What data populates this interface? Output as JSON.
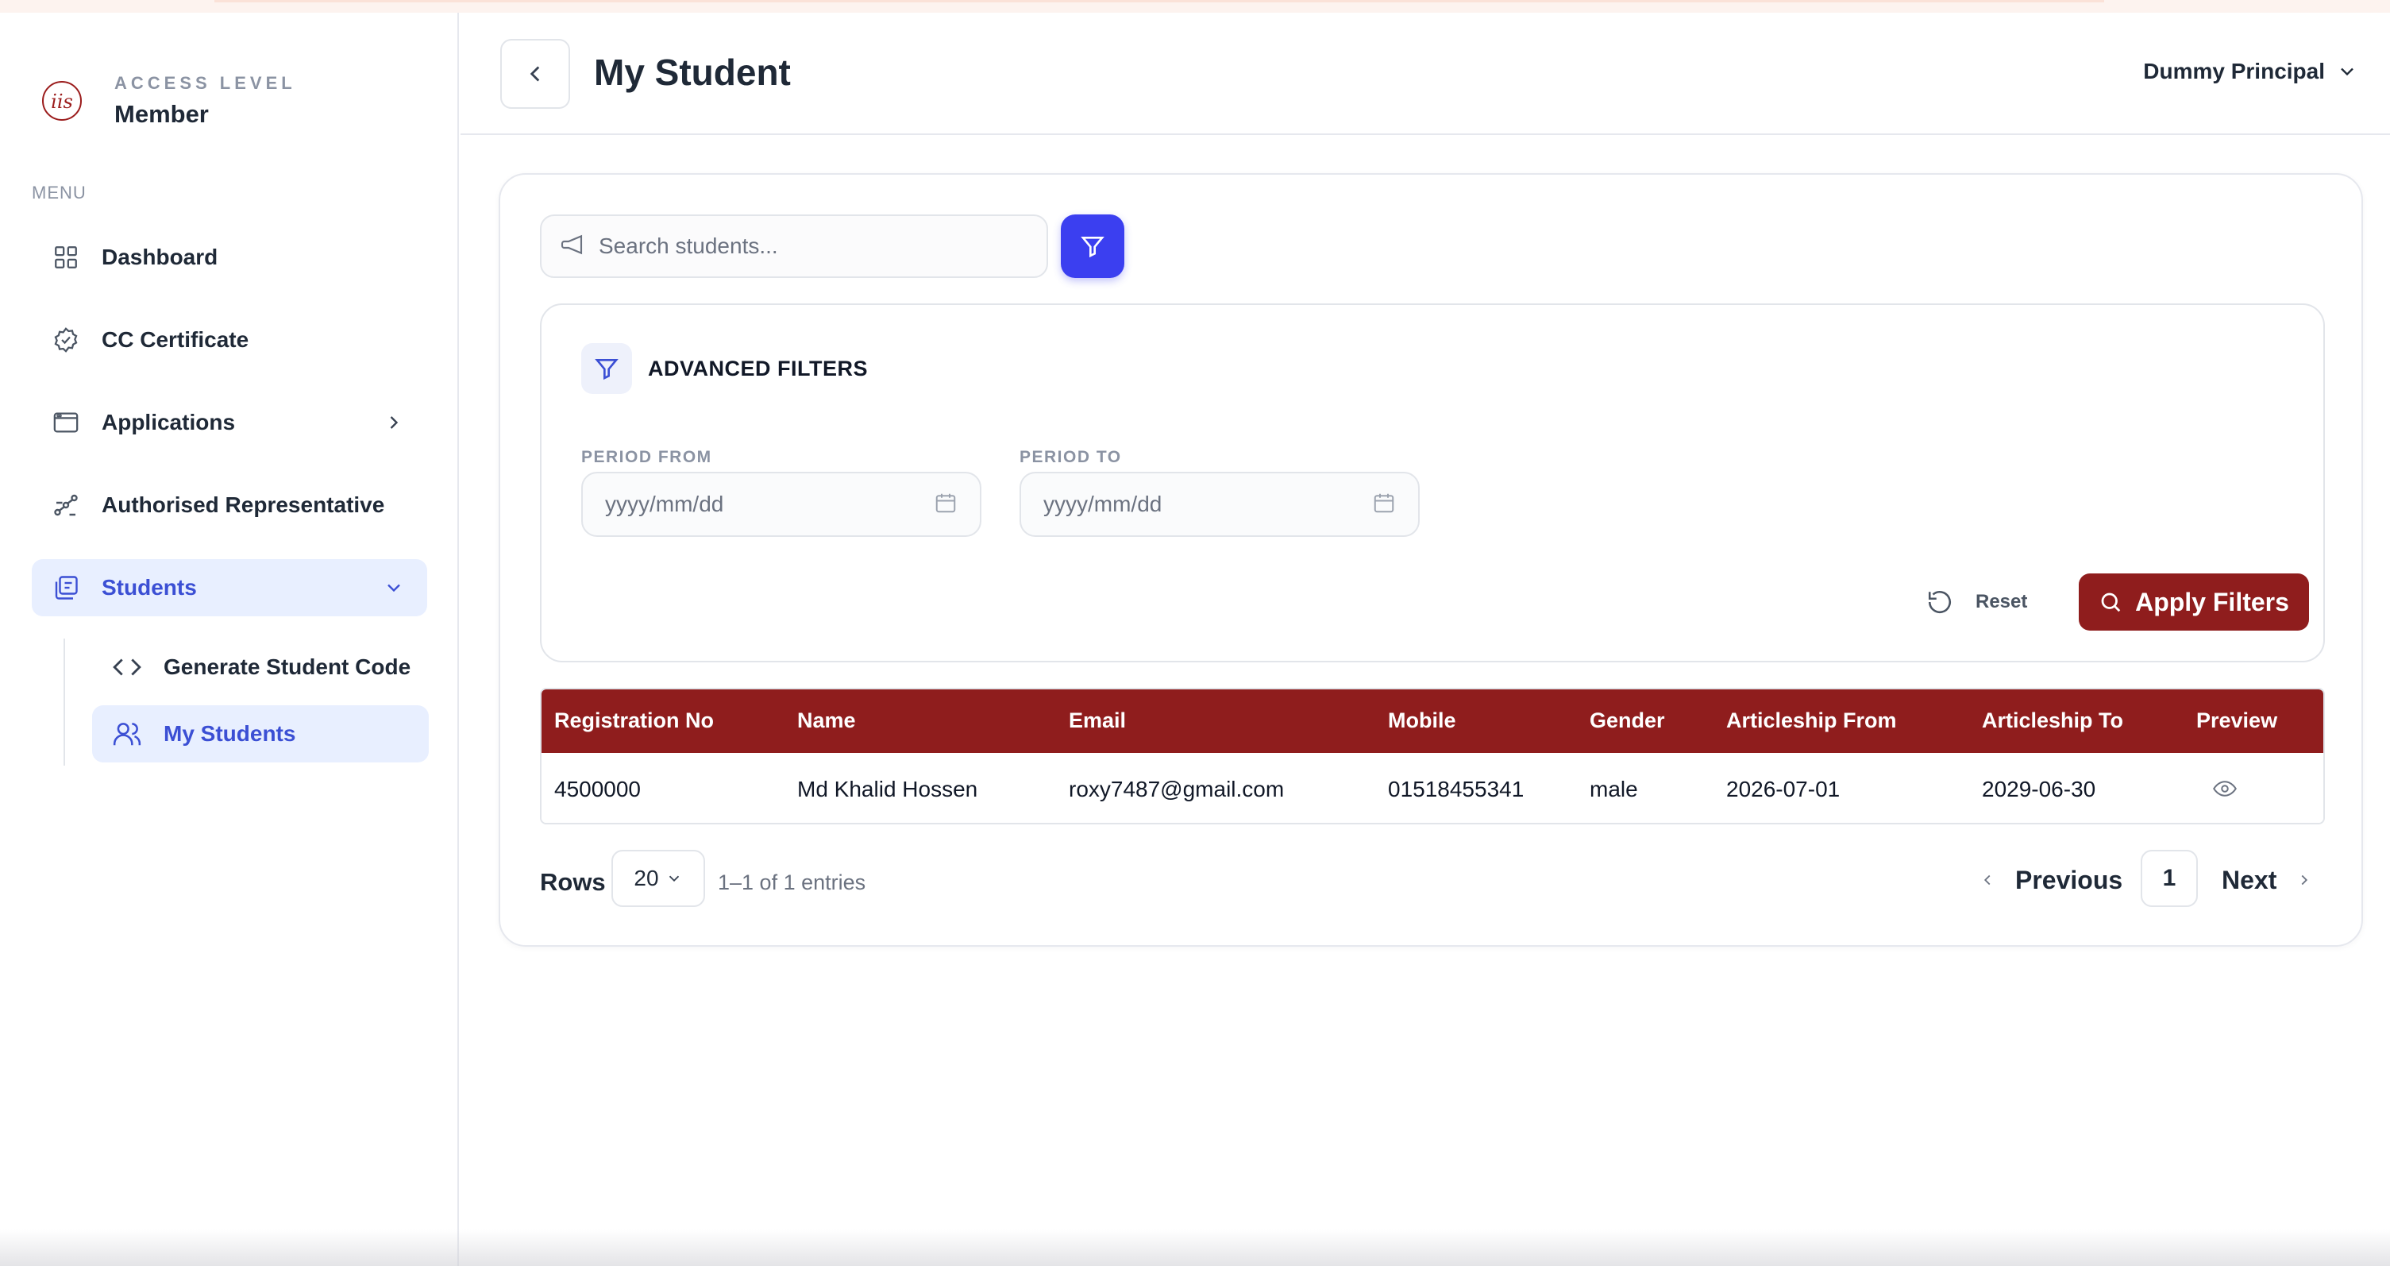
{
  "colors": {
    "primary": "#8f1d1d",
    "accent_blue": "#3b3ff0",
    "active_nav_bg": "#e8efff",
    "active_nav_text": "#3b4fd4"
  },
  "sidebar": {
    "logo_text": "iis",
    "access_label": "ACCESS LEVEL",
    "access_value": "Member",
    "menu_label": "MENU",
    "items": [
      {
        "label": "Dashboard",
        "icon": "grid-icon"
      },
      {
        "label": "CC Certificate",
        "icon": "badge-check-icon"
      },
      {
        "label": "Applications",
        "icon": "window-icon"
      },
      {
        "label": "Authorised Representative",
        "icon": "share-nodes-icon"
      },
      {
        "label": "Students",
        "icon": "library-icon"
      }
    ],
    "subitems": [
      {
        "label": "Generate Student Code",
        "icon": "code-icon"
      },
      {
        "label": "My Students",
        "icon": "users-icon"
      }
    ]
  },
  "header": {
    "title": "My Student",
    "user": "Dummy Principal"
  },
  "search": {
    "placeholder": "Search students..."
  },
  "filters": {
    "title": "ADVANCED FILTERS",
    "period_from_label": "PERIOD FROM",
    "period_to_label": "PERIOD TO",
    "period_from_placeholder": "yyyy/mm/dd",
    "period_to_placeholder": "yyyy/mm/dd",
    "reset_label": "Reset",
    "apply_label": "Apply Filters"
  },
  "table": {
    "columns": [
      "Registration No",
      "Name",
      "Email",
      "Mobile",
      "Gender",
      "Articleship From",
      "Articleship To",
      "Preview"
    ],
    "rows": [
      [
        "4500000",
        "Md Khalid Hossen",
        "roxy7487@gmail.com",
        "01518455341",
        "male",
        "2026-07-01",
        "2029-06-30"
      ]
    ]
  },
  "pagination": {
    "rows_label": "Rows",
    "rows_per_page": "20",
    "entries_text": "1–1 of 1 entries",
    "previous_label": "Previous",
    "current_page": "1",
    "next_label": "Next"
  }
}
